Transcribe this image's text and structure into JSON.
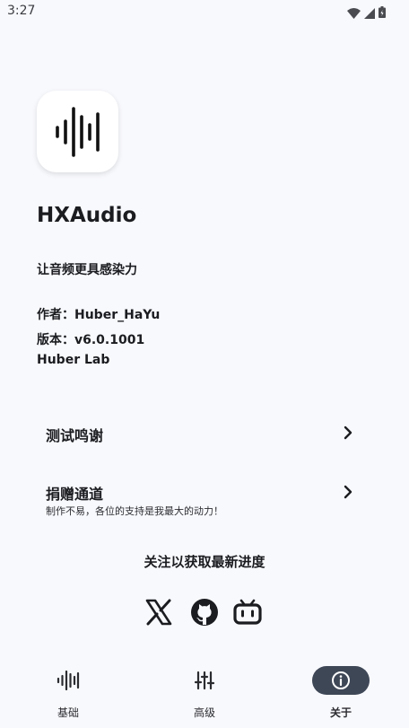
{
  "status_bar": {
    "time": "3:27"
  },
  "app": {
    "name": "HXAudio",
    "slogan": "让音频更具感染力",
    "author_label": "作者：",
    "author": "Huber_HaYu",
    "version_label": "版本：",
    "version": "v6.0.1001",
    "lab": "Huber Lab"
  },
  "menu": {
    "thanks": {
      "title": "测试鸣谢"
    },
    "donate": {
      "title": "捐赠通道",
      "subtitle": "制作不易，各位的支持是我最大的动力！"
    }
  },
  "follow": {
    "title": "关注以获取最新进度",
    "links": [
      {
        "icon": "x-twitter-icon"
      },
      {
        "icon": "github-icon"
      },
      {
        "icon": "bilibili-icon"
      }
    ]
  },
  "nav": {
    "items": [
      {
        "label": "基础",
        "icon": "waveform-icon",
        "active": false
      },
      {
        "label": "高级",
        "icon": "sliders-icon",
        "active": false
      },
      {
        "label": "关于",
        "icon": "info-icon",
        "active": true
      }
    ]
  },
  "colors": {
    "background": "#f8f9fd",
    "active_pill": "#3e4756",
    "text": "#1b1c20"
  }
}
